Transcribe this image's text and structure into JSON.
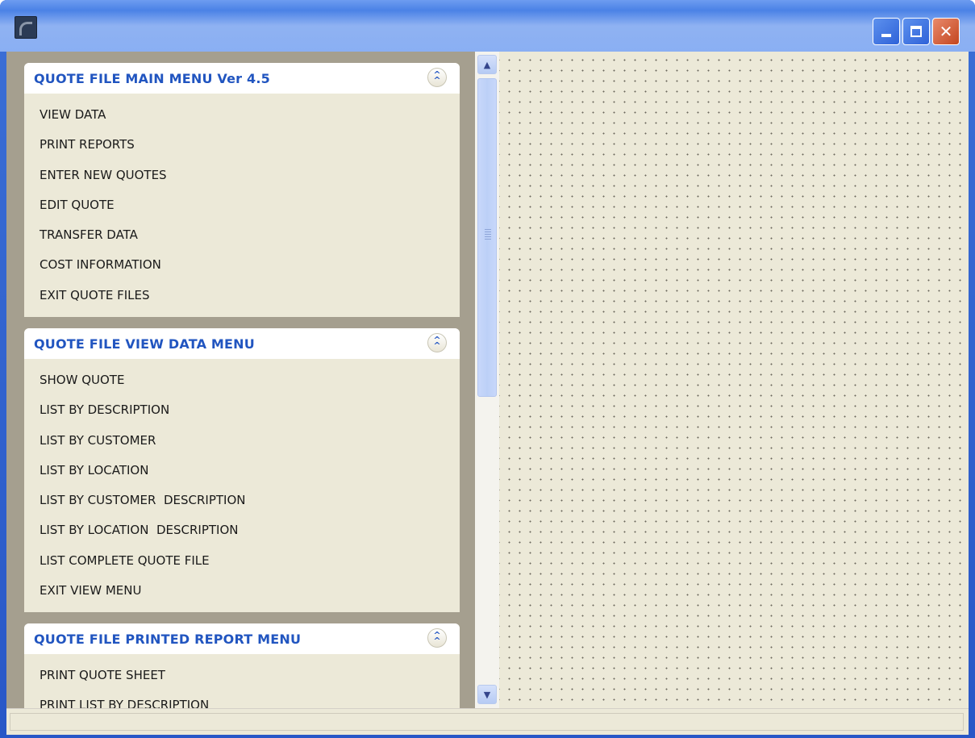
{
  "window": {
    "buttons": {
      "minimize": "minimize-icon",
      "maximize": "maximize-icon",
      "close": "close-icon"
    },
    "accent": "#2155c0"
  },
  "menus": [
    {
      "title": "QUOTE FILE MAIN MENU Ver 4.5",
      "items": [
        "VIEW DATA",
        "PRINT REPORTS",
        "ENTER NEW QUOTES",
        "EDIT QUOTE",
        "TRANSFER DATA",
        "COST INFORMATION",
        "EXIT QUOTE FILES"
      ]
    },
    {
      "title": "QUOTE FILE VIEW DATA MENU",
      "items": [
        "SHOW QUOTE",
        "LIST BY DESCRIPTION",
        "LIST BY CUSTOMER",
        "LIST BY LOCATION",
        "LIST BY CUSTOMER  DESCRIPTION",
        "LIST BY LOCATION  DESCRIPTION",
        "LIST COMPLETE QUOTE FILE",
        "EXIT VIEW MENU"
      ]
    },
    {
      "title": "QUOTE FILE PRINTED REPORT MENU",
      "items": [
        "PRINT QUOTE SHEET",
        "PRINT LIST BY DESCRIPTION"
      ]
    }
  ],
  "status": {
    "text": ""
  }
}
